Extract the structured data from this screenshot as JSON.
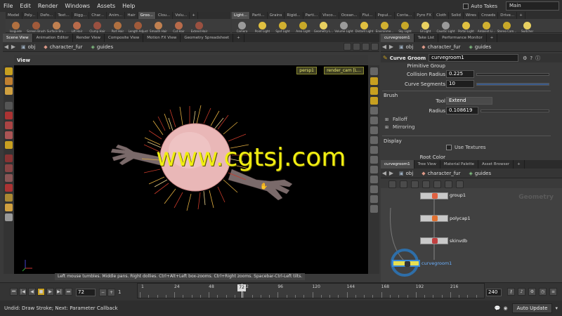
{
  "menubar": {
    "items": [
      "File",
      "Edit",
      "Render",
      "Windows",
      "Assets",
      "Help"
    ],
    "auto_takes": "Auto Takes",
    "desktop": "Main"
  },
  "shelf_left": {
    "tabs": [
      "Model",
      "Poly...",
      "Defo...",
      "Text...",
      "Rigg...",
      "Char...",
      "Anim...",
      "Hair",
      "Groo...",
      "Clou...",
      "Volu..."
    ],
    "active_tab": 8,
    "tools": [
      "Isoguide",
      "Screen Brush",
      "Surface Bru...",
      "Lift Hair",
      "Clump Hair",
      "Part Hair",
      "Length Adjust",
      "Smooth Hair",
      "Cut Hair",
      "Extend Hair"
    ]
  },
  "shelf_right": {
    "tabs": [
      "Light...",
      "Parti...",
      "Grains",
      "Rigid...",
      "Parti...",
      "Visco...",
      "Ocean...",
      "Flui...",
      "Popul...",
      "Conta...",
      "Pyro FX",
      "Cloth",
      "Solid",
      "Wires",
      "Crowds",
      "Drive..."
    ],
    "active_tab": 0,
    "tools": [
      "Camera",
      "Point Light",
      "Spot Light",
      "Area Light",
      "Geometry L...",
      "Volume Light",
      "Distant Light",
      "Environme...",
      "Sky Light",
      "GI Light",
      "Caustic Light",
      "Portal Light",
      "Ambient Li...",
      "Stereo Cam...",
      "Switcher"
    ]
  },
  "left_panes": {
    "tabs": [
      "Scene View",
      "Animation Editor",
      "Render View",
      "Composite View",
      "Motion FX View",
      "Geometry Spreadsheet"
    ]
  },
  "left_path": {
    "context": "obj",
    "object": "character_fur",
    "node": "guides"
  },
  "view": {
    "title": "View",
    "persp": "persp1",
    "camera": "render_cam [L..."
  },
  "viewport_hint": "Left mouse tumbles. Middle pans. Right dollies. Ctrl+Alt+Left box-zooms. Ctrl+Right zooms. Spacebar-Ctrl-Left tilts.",
  "watermark": "www.cgtsj.com",
  "right_top_panes": {
    "tabs": [
      "curvegroom1",
      "Take List",
      "Performance Monitor"
    ]
  },
  "right_path": {
    "context": "obj",
    "object": "character_fur",
    "node": "guides"
  },
  "params": {
    "node_type": "Curve Groom",
    "node_name": "curvegroom1",
    "primitive_group": "Primitive Group",
    "collision_radius_label": "Collision Radius",
    "collision_radius": "0.225",
    "curve_segments_label": "Curve Segments",
    "curve_segments": "10",
    "brush_section": "Brush",
    "tool_label": "Tool",
    "tool_value": "Extend",
    "radius_label": "Radius",
    "radius_value": "0.108619",
    "falloff": "Falloff",
    "mirroring": "Mirroring",
    "display_section": "Display",
    "use_textures": "Use Textures",
    "root_color": "Root Color"
  },
  "right_bottom_panes": {
    "tabs": [
      "curvegroom1",
      "Tree View",
      "Material Palette",
      "Asset Browser"
    ]
  },
  "right_bottom_path": {
    "context": "obj",
    "object": "character_fur",
    "node": "guides"
  },
  "network": {
    "watermark_label": "Geometry",
    "nodes": [
      "group1",
      "polycap1",
      "skinvdb",
      "curvegroom1"
    ]
  },
  "timeline": {
    "current_frame": "72",
    "start_frame": "1",
    "end_frame": "240",
    "step": "1",
    "ruler_labels": [
      "1",
      "24",
      "48",
      "72",
      "96",
      "120",
      "144",
      "168",
      "192",
      "216"
    ],
    "auto_update": "Auto Update"
  },
  "status": "Undid: Draw Stroke; Next: Parameter Callback",
  "colors": {
    "accent_yellow": "#e8e870",
    "selected_node": "#3a8ad8",
    "viewport_bg": "#000000"
  }
}
